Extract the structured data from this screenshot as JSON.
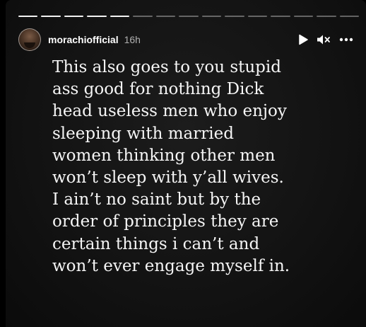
{
  "progress": {
    "total": 15,
    "seen": 5
  },
  "header": {
    "username": "morachiofficial",
    "time": "16h",
    "avatar_icon": "user-avatar"
  },
  "controls": {
    "play_icon": "play-icon",
    "mute_icon": "speaker-muted-icon",
    "more_icon": "more-options-icon"
  },
  "caption": {
    "lines": [
      "This also goes to you stupid",
      "ass good for nothing Dick",
      "head useless men who enjoy",
      "sleeping with married",
      "women thinking other men",
      "won’t sleep with y’all wives.",
      "I ain’t no saint but by the",
      "order of principles they are",
      "certain things i can’t and",
      "won’t ever engage myself in."
    ]
  },
  "colors": {
    "background": "#000000",
    "text": "#f5f5f5"
  }
}
